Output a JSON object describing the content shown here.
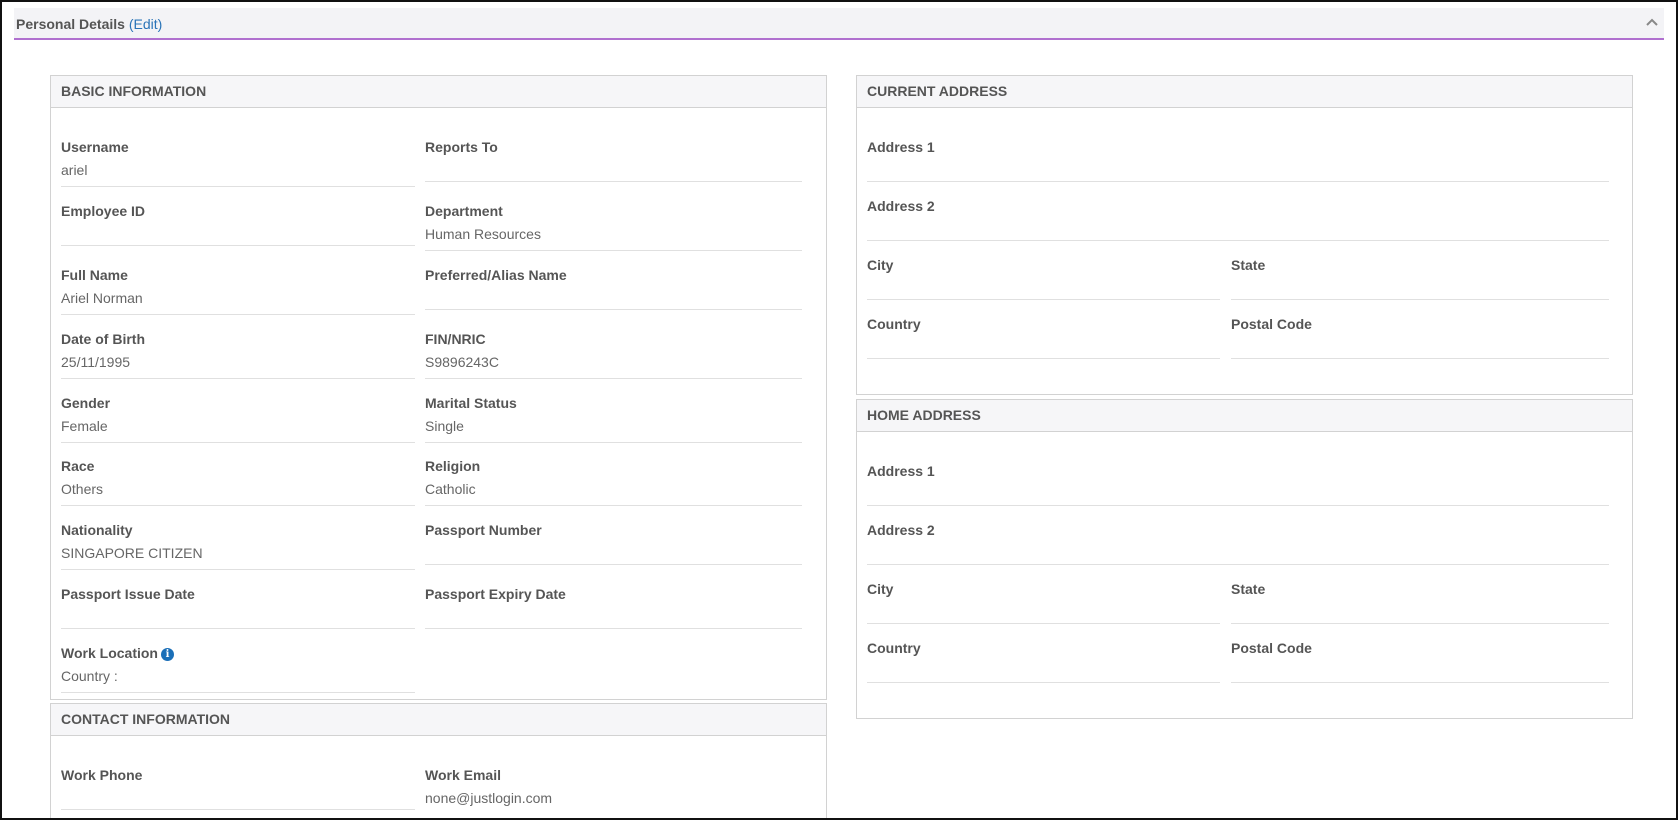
{
  "header": {
    "title": "Personal Details",
    "edit_label": "(Edit)"
  },
  "basic_info": {
    "title": "BASIC INFORMATION",
    "username": {
      "label": "Username",
      "value": "ariel"
    },
    "reports_to": {
      "label": "Reports To",
      "value": ""
    },
    "employee_id": {
      "label": "Employee ID",
      "value": ""
    },
    "department": {
      "label": "Department",
      "value": "Human Resources"
    },
    "full_name": {
      "label": "Full Name",
      "value": "Ariel Norman"
    },
    "preferred_name": {
      "label": "Preferred/Alias Name",
      "value": ""
    },
    "dob": {
      "label": "Date of Birth",
      "value": "25/11/1995"
    },
    "fin": {
      "label": "FIN/NRIC",
      "value": "S9896243C"
    },
    "gender": {
      "label": "Gender",
      "value": "Female"
    },
    "marital": {
      "label": "Marital Status",
      "value": "Single"
    },
    "race": {
      "label": "Race",
      "value": "Others"
    },
    "religion": {
      "label": "Religion",
      "value": "Catholic"
    },
    "nationality": {
      "label": "Nationality",
      "value": "SINGAPORE CITIZEN"
    },
    "passport_number": {
      "label": "Passport Number",
      "value": ""
    },
    "passport_issue": {
      "label": "Passport Issue Date",
      "value": ""
    },
    "passport_expiry": {
      "label": "Passport Expiry Date",
      "value": ""
    },
    "work_location": {
      "label": "Work Location",
      "value": "Country :"
    }
  },
  "contact_info": {
    "title": "CONTACT INFORMATION",
    "work_phone": {
      "label": "Work Phone",
      "value": ""
    },
    "work_email": {
      "label": "Work Email",
      "value": "none@justlogin.com"
    }
  },
  "current_address": {
    "title": "CURRENT ADDRESS",
    "address1": {
      "label": "Address 1",
      "value": ""
    },
    "address2": {
      "label": "Address 2",
      "value": ""
    },
    "city": {
      "label": "City",
      "value": ""
    },
    "state": {
      "label": "State",
      "value": ""
    },
    "country": {
      "label": "Country",
      "value": ""
    },
    "postal": {
      "label": "Postal Code",
      "value": ""
    }
  },
  "home_address": {
    "title": "HOME ADDRESS",
    "address1": {
      "label": "Address 1",
      "value": ""
    },
    "address2": {
      "label": "Address 2",
      "value": ""
    },
    "city": {
      "label": "City",
      "value": ""
    },
    "state": {
      "label": "State",
      "value": ""
    },
    "country": {
      "label": "Country",
      "value": ""
    },
    "postal": {
      "label": "Postal Code",
      "value": ""
    }
  },
  "icons": {
    "collapse": "chevron-up-icon",
    "info": "info-icon"
  }
}
